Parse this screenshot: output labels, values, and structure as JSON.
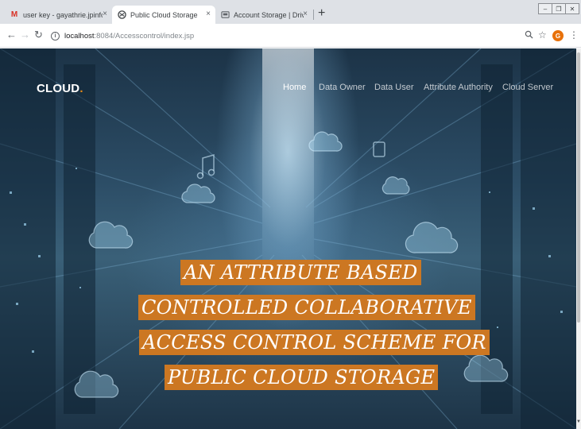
{
  "browser": {
    "tabs": [
      {
        "icon": "gmail-icon",
        "title": "user key - gayathrie.jpinfotech@",
        "active": false
      },
      {
        "icon": "globe-icon",
        "title": "Public Cloud Storage",
        "active": true
      },
      {
        "icon": "drivehq-icon",
        "title": "Account Storage | DriveHQ",
        "active": false
      }
    ],
    "close_glyph": "×",
    "new_tab_glyph": "+",
    "url_host": "localhost",
    "url_path": ":8084/Accesscontrol/index.jsp",
    "profile_initial": "G"
  },
  "site": {
    "brand": "CLOUD",
    "brand_dot": ".",
    "nav": [
      {
        "label": "Home",
        "active": true
      },
      {
        "label": "Data Owner",
        "active": false
      },
      {
        "label": "Data User",
        "active": false
      },
      {
        "label": "Attribute Authority",
        "active": false
      },
      {
        "label": "Cloud Server",
        "active": false
      }
    ],
    "banner_lines": [
      "AN ATTRIBUTE BASED",
      "CONTROLLED COLLABORATIVE",
      "ACCESS CONTROL SCHEME FOR",
      "PUBLIC CLOUD STORAGE"
    ]
  },
  "colors": {
    "accent": "#cc7722",
    "brand_dot": "#e88b17"
  }
}
